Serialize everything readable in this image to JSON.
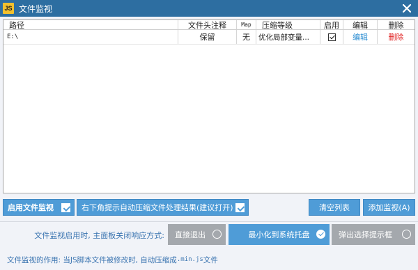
{
  "window": {
    "app_icon_text": "JS",
    "title": "文件监视",
    "close_icon": "close-icon"
  },
  "table": {
    "columns": {
      "path": "路径",
      "header_comment": "文件头注释",
      "map": "Map",
      "compression": "压缩等级",
      "enable": "启用",
      "edit": "编辑",
      "delete": "删除"
    },
    "rows": [
      {
        "path": "E:\\",
        "header_comment": "保留",
        "map": "无",
        "compression": "优化局部变量...",
        "enabled": true,
        "edit": "编辑",
        "delete": "删除"
      }
    ]
  },
  "buttons": {
    "enable_watch": "启用文件监视",
    "enable_watch_checked": true,
    "notify": "右下角提示自动压缩文件处理结果(建议打开)",
    "notify_checked": true,
    "clear_list": "清空列表",
    "add_watch": "添加监视(A)"
  },
  "close_options": {
    "label": "文件监视启用时, 主面板关闭响应方式:",
    "options": [
      {
        "label": "直接退出",
        "selected": false
      },
      {
        "label": "最小化到系统托盘",
        "selected": true
      },
      {
        "label": "弹出选择提示框",
        "selected": false
      }
    ]
  },
  "footer": {
    "prefix": "文件监视的作用: 当JS脚本文件被修改时, 自动压缩成",
    "ext": ".min.js",
    "suffix": "文件"
  },
  "colors": {
    "titlebar": "#2d6ea1",
    "accent": "#4f9cd7",
    "option_grey": "#a4a8ad",
    "link_edit": "#2f8fd3",
    "link_delete": "#e02020"
  }
}
